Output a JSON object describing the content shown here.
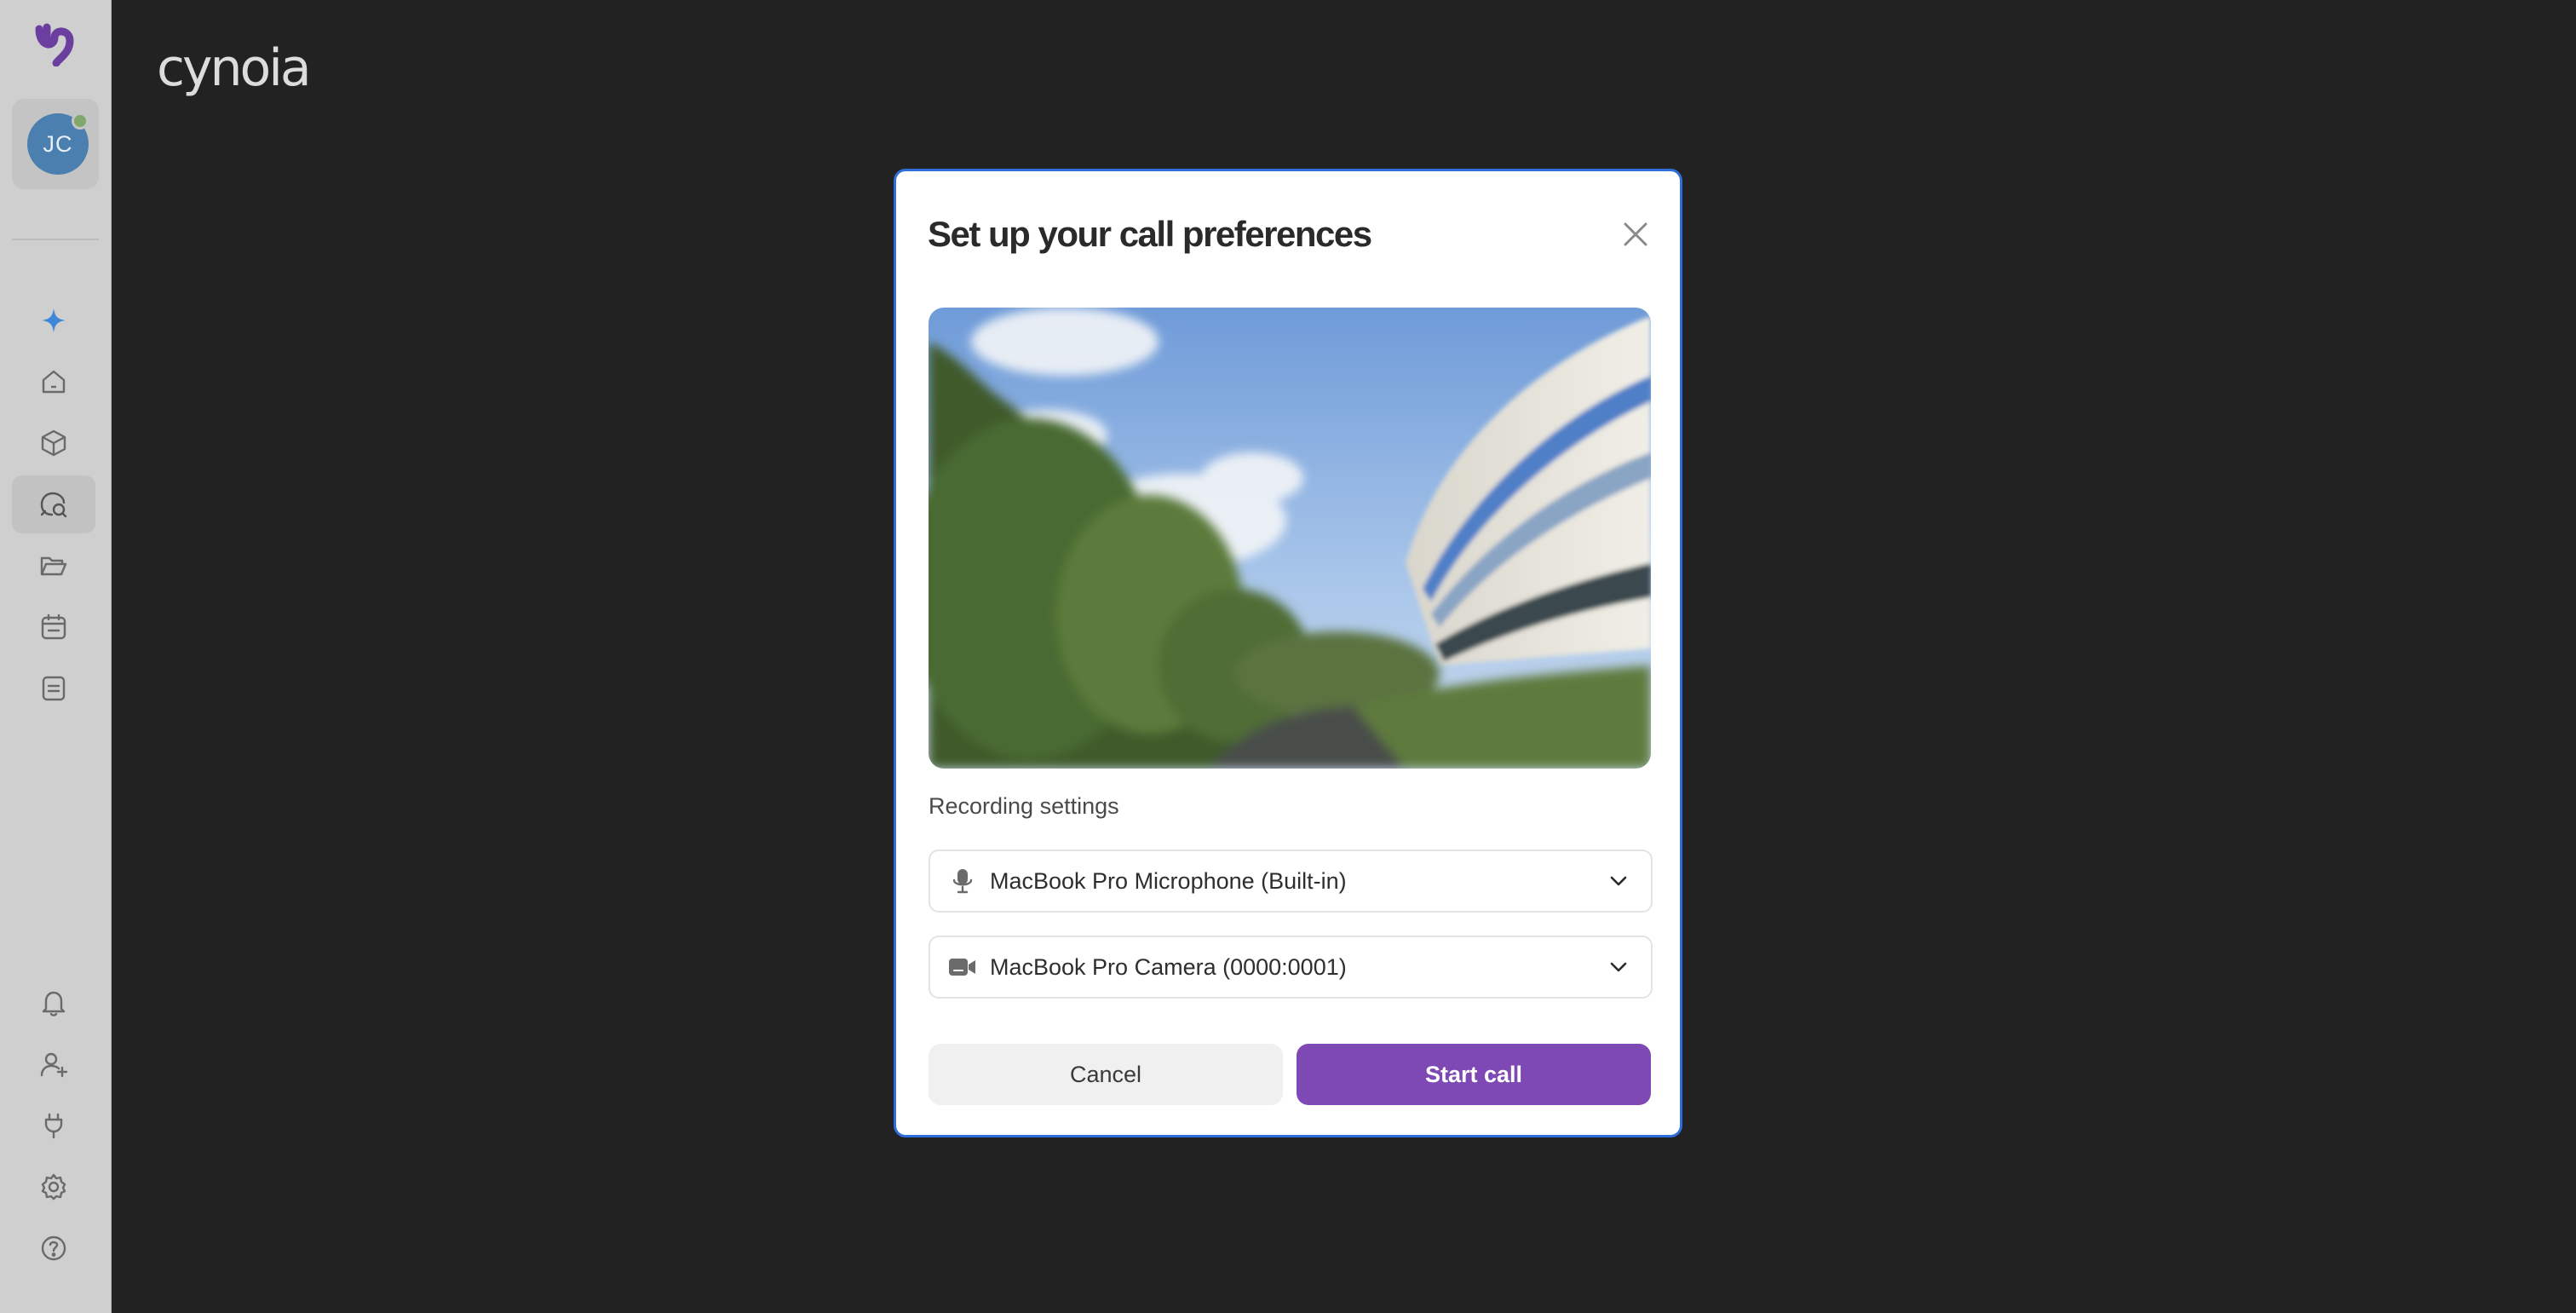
{
  "app": {
    "brand": "cynoia"
  },
  "sidebar": {
    "avatar_initials": "JC",
    "presence_color": "#7fa86a",
    "accent_color": "#7e49b4",
    "top_items": [
      {
        "name": "ai-assistant",
        "icon": "sparkle-icon"
      },
      {
        "name": "home",
        "icon": "home-icon"
      },
      {
        "name": "workspaces",
        "icon": "cube-icon"
      },
      {
        "name": "chat",
        "icon": "chat-search-icon",
        "active": true
      },
      {
        "name": "files",
        "icon": "folder-icon"
      },
      {
        "name": "calendar",
        "icon": "calendar-icon"
      },
      {
        "name": "notes",
        "icon": "note-icon"
      }
    ],
    "bottom_items": [
      {
        "name": "notifications",
        "icon": "bell-icon"
      },
      {
        "name": "invite-user",
        "icon": "user-plus-icon"
      },
      {
        "name": "integrations",
        "icon": "plug-icon"
      },
      {
        "name": "settings",
        "icon": "gear-icon"
      },
      {
        "name": "help",
        "icon": "question-icon"
      }
    ]
  },
  "modal": {
    "title": "Set up your call preferences",
    "recording_label": "Recording settings",
    "microphone": {
      "value": "MacBook Pro Microphone (Built-in)",
      "icon": "microphone-icon"
    },
    "camera": {
      "value": "MacBook Pro Camera (0000:0001)",
      "icon": "video-camera-icon"
    },
    "cancel_label": "Cancel",
    "start_label": "Start call",
    "border_color": "#2f6fdc"
  }
}
